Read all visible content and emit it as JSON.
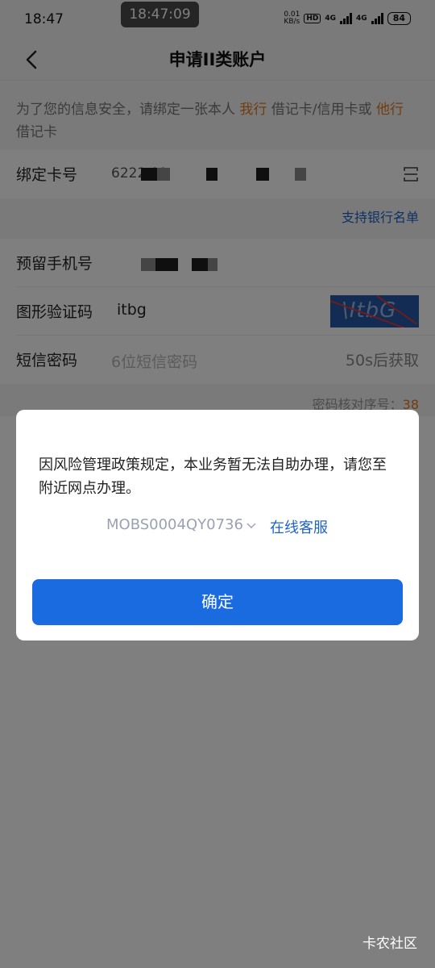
{
  "status_bar": {
    "time": "18:47",
    "recording_time": "18:47:09",
    "net_speed_value": "0.01",
    "net_speed_unit": "KB/s",
    "hd_label": "HD",
    "network_1": "4G",
    "network_2": "4G",
    "battery": "84"
  },
  "nav": {
    "title": "申请II类账户"
  },
  "notice": {
    "part1": "为了您的信息安全，请绑定一张本人 ",
    "our_bank": "我行",
    "part2": " 借记卡/信用卡或 ",
    "other_bank": "他行",
    "part3": " 借记卡"
  },
  "form": {
    "card": {
      "label": "绑定卡号",
      "partial_value": "6222 02"
    },
    "bank_list_link": "支持银行名单",
    "phone": {
      "label": "预留手机号"
    },
    "captcha": {
      "label": "图形验证码",
      "value": "itbg",
      "image_text": "\\ItbG"
    },
    "sms": {
      "label": "短信密码",
      "placeholder": "6位短信密码",
      "countdown": "50s后获取"
    },
    "serial": {
      "label": "密码核对序号：",
      "value": "38"
    }
  },
  "dialog": {
    "message": "因风险管理政策规定，本业务暂无法自助办理，请您至附近网点办理。",
    "code": "MOBS0004QY0736",
    "service_link": "在线客服",
    "confirm_label": "确定"
  },
  "watermark": "卡农社区"
}
